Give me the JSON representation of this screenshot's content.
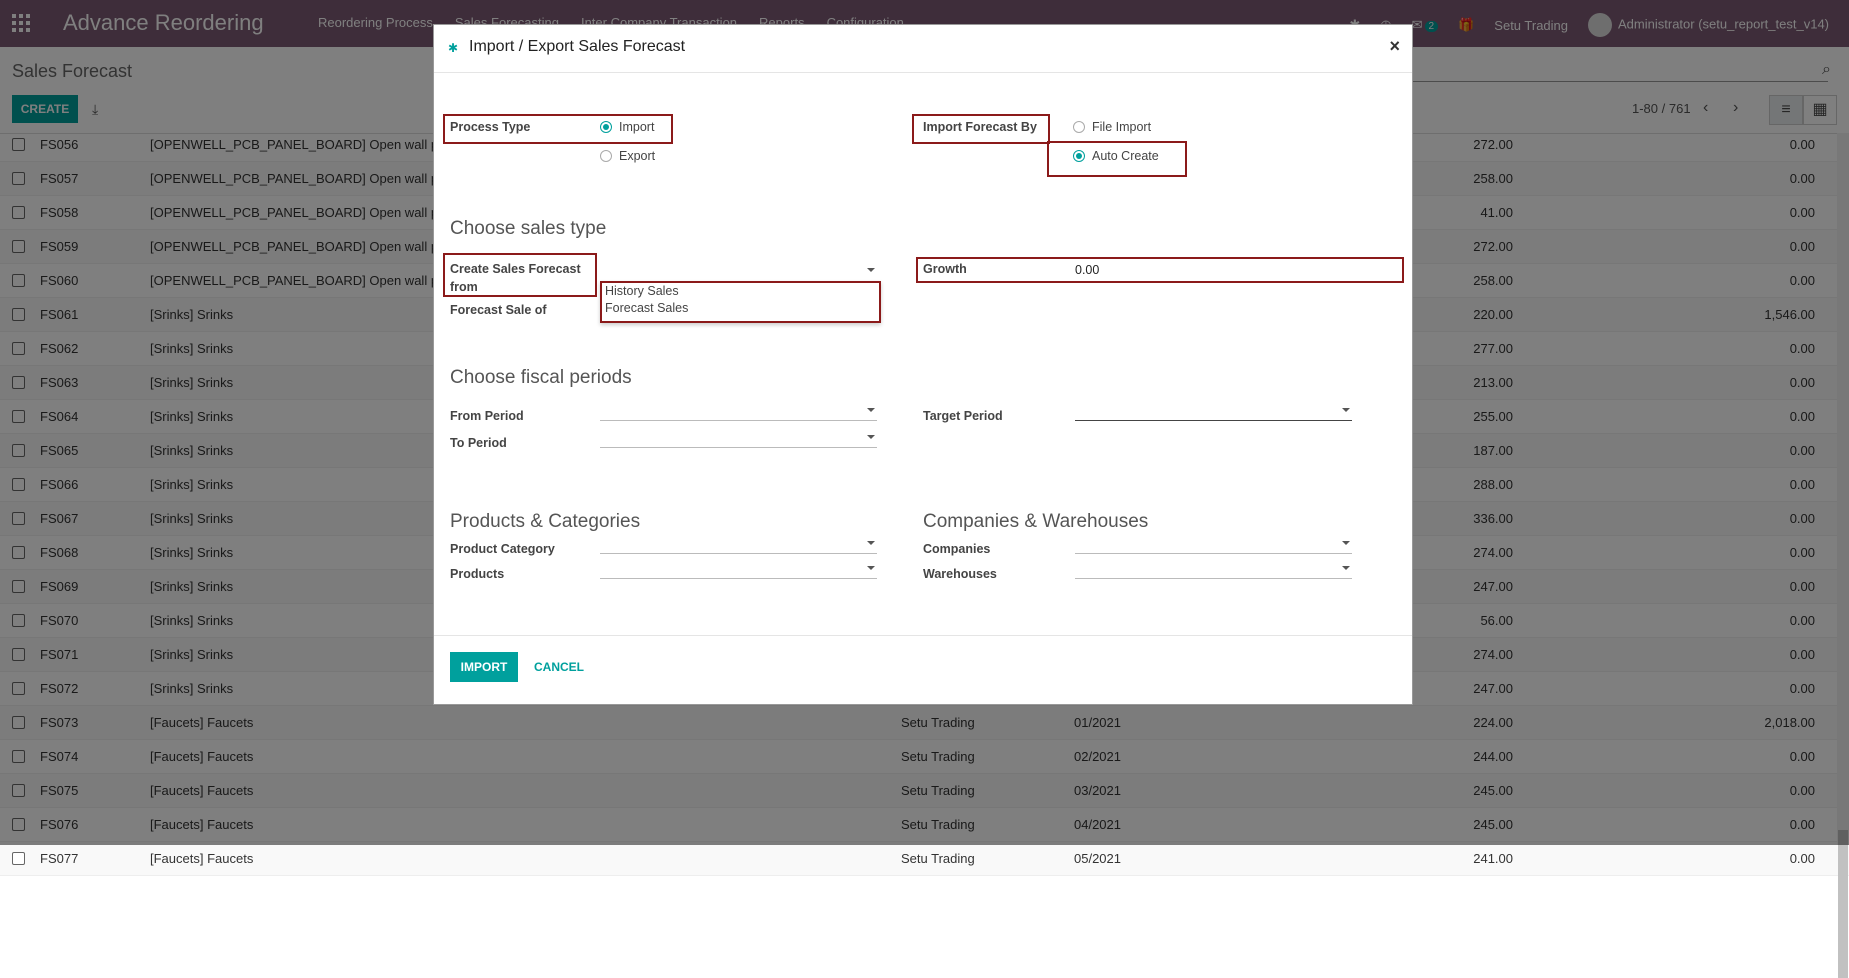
{
  "navbar": {
    "brand": "Advance Reordering",
    "menu": [
      "Reordering Process",
      "Sales Forecasting",
      "Inter Company Transaction",
      "Reports",
      "Configuration"
    ],
    "chat_count": "2",
    "company": "Setu Trading",
    "user": "Administrator (setu_report_test_v14)"
  },
  "control_panel": {
    "title": "Sales Forecast",
    "create_label": "CREATE",
    "pager": "1-80 / 761"
  },
  "rows": [
    {
      "name": "FS056",
      "product": "[OPENWELL_PCB_PANEL_BOARD] Open wall pcb",
      "company": "",
      "period": "",
      "qty": "272.00",
      "val": "0.00"
    },
    {
      "name": "FS057",
      "product": "[OPENWELL_PCB_PANEL_BOARD] Open wall pcb",
      "company": "",
      "period": "",
      "qty": "258.00",
      "val": "0.00"
    },
    {
      "name": "FS058",
      "product": "[OPENWELL_PCB_PANEL_BOARD] Open wall pcb",
      "company": "",
      "period": "",
      "qty": "41.00",
      "val": "0.00"
    },
    {
      "name": "FS059",
      "product": "[OPENWELL_PCB_PANEL_BOARD] Open wall pcb",
      "company": "",
      "period": "",
      "qty": "272.00",
      "val": "0.00"
    },
    {
      "name": "FS060",
      "product": "[OPENWELL_PCB_PANEL_BOARD] Open wall pcb",
      "company": "",
      "period": "",
      "qty": "258.00",
      "val": "0.00"
    },
    {
      "name": "FS061",
      "product": "[Srinks] Srinks",
      "company": "",
      "period": "",
      "qty": "220.00",
      "val": "1,546.00"
    },
    {
      "name": "FS062",
      "product": "[Srinks] Srinks",
      "company": "",
      "period": "",
      "qty": "277.00",
      "val": "0.00"
    },
    {
      "name": "FS063",
      "product": "[Srinks] Srinks",
      "company": "",
      "period": "",
      "qty": "213.00",
      "val": "0.00"
    },
    {
      "name": "FS064",
      "product": "[Srinks] Srinks",
      "company": "",
      "period": "",
      "qty": "255.00",
      "val": "0.00"
    },
    {
      "name": "FS065",
      "product": "[Srinks] Srinks",
      "company": "",
      "period": "",
      "qty": "187.00",
      "val": "0.00"
    },
    {
      "name": "FS066",
      "product": "[Srinks] Srinks",
      "company": "",
      "period": "",
      "qty": "288.00",
      "val": "0.00"
    },
    {
      "name": "FS067",
      "product": "[Srinks] Srinks",
      "company": "",
      "period": "",
      "qty": "336.00",
      "val": "0.00"
    },
    {
      "name": "FS068",
      "product": "[Srinks] Srinks",
      "company": "",
      "period": "",
      "qty": "274.00",
      "val": "0.00"
    },
    {
      "name": "FS069",
      "product": "[Srinks] Srinks",
      "company": "",
      "period": "",
      "qty": "247.00",
      "val": "0.00"
    },
    {
      "name": "FS070",
      "product": "[Srinks] Srinks",
      "company": "",
      "period": "",
      "qty": "56.00",
      "val": "0.00"
    },
    {
      "name": "FS071",
      "product": "[Srinks] Srinks",
      "company": "",
      "period": "",
      "qty": "274.00",
      "val": "0.00"
    },
    {
      "name": "FS072",
      "product": "[Srinks] Srinks",
      "company": "",
      "period": "",
      "qty": "247.00",
      "val": "0.00"
    },
    {
      "name": "FS073",
      "product": "[Faucets] Faucets",
      "company": "Setu Trading",
      "period": "01/2021",
      "qty": "224.00",
      "val": "2,018.00"
    },
    {
      "name": "FS074",
      "product": "[Faucets] Faucets",
      "company": "Setu Trading",
      "period": "02/2021",
      "qty": "244.00",
      "val": "0.00"
    },
    {
      "name": "FS075",
      "product": "[Faucets] Faucets",
      "company": "Setu Trading",
      "period": "03/2021",
      "qty": "245.00",
      "val": "0.00"
    },
    {
      "name": "FS076",
      "product": "[Faucets] Faucets",
      "company": "Setu Trading",
      "period": "04/2021",
      "qty": "245.00",
      "val": "0.00"
    },
    {
      "name": "FS077",
      "product": "[Faucets] Faucets",
      "company": "Setu Trading",
      "period": "05/2021",
      "qty": "241.00",
      "val": "0.00"
    }
  ],
  "modal": {
    "title": "Import / Export Sales Forecast",
    "process_type_label": "Process Type",
    "process_options": [
      "Import",
      "Export"
    ],
    "import_by_label": "Import Forecast By",
    "import_by_options": [
      "File Import",
      "Auto Create"
    ],
    "section_sales": "Choose sales type",
    "create_from_label": "Create Sales Forecast from",
    "forecast_sale_of_label": "Forecast Sale of",
    "dropdown_options": [
      "History Sales",
      "Forecast Sales"
    ],
    "growth_label": "Growth",
    "growth_value": "0.00",
    "section_fiscal": "Choose fiscal periods",
    "from_period_label": "From Period",
    "to_period_label": "To Period",
    "target_period_label": "Target Period",
    "section_products": "Products & Categories",
    "section_companies": "Companies & Warehouses",
    "product_category_label": "Product Category",
    "products_label": "Products",
    "companies_label": "Companies",
    "warehouses_label": "Warehouses",
    "import_button": "IMPORT",
    "cancel_button": "CANCEL"
  },
  "colors": {
    "navbar": "#7c5a74",
    "accent": "#00a09d",
    "highlight": "#8b1a1a"
  }
}
